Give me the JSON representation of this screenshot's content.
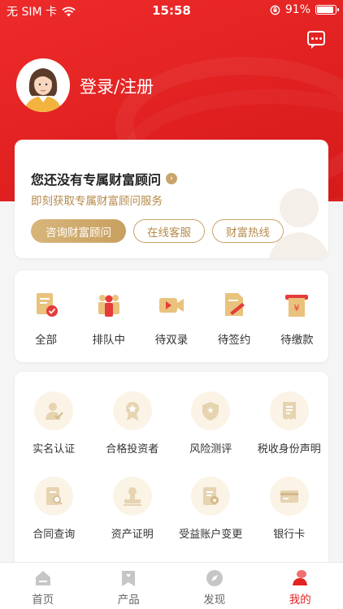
{
  "status_bar": {
    "carrier": "无 SIM 卡",
    "time": "15:58",
    "battery": "91%",
    "battery_level": 0.91
  },
  "header": {
    "login_label": "登录/注册"
  },
  "advisor": {
    "title": "您还没有专属财富顾问",
    "subtitle": "即刻获取专属财富顾问服务",
    "buttons": [
      "咨询财富顾问",
      "在线客服",
      "财富热线"
    ]
  },
  "orders": [
    {
      "label": "全部",
      "icon": "order-all-icon"
    },
    {
      "label": "排队中",
      "icon": "queue-icon"
    },
    {
      "label": "待双录",
      "icon": "video-record-icon"
    },
    {
      "label": "待签约",
      "icon": "sign-icon"
    },
    {
      "label": "待缴款",
      "icon": "payment-icon"
    }
  ],
  "services": [
    {
      "label": "实名认证",
      "icon": "id-verify-icon"
    },
    {
      "label": "合格投资者",
      "icon": "qualified-investor-icon"
    },
    {
      "label": "风险测评",
      "icon": "risk-shield-icon"
    },
    {
      "label": "税收身份声明",
      "icon": "tax-document-icon"
    },
    {
      "label": "合同查询",
      "icon": "contract-search-icon"
    },
    {
      "label": "资产证明",
      "icon": "asset-stamp-icon"
    },
    {
      "label": "受益账户变更",
      "icon": "account-change-icon"
    },
    {
      "label": "银行卡",
      "icon": "bank-card-icon"
    }
  ],
  "tabbar": [
    {
      "label": "首页",
      "icon": "home-icon"
    },
    {
      "label": "产品",
      "icon": "product-icon"
    },
    {
      "label": "发现",
      "icon": "compass-icon"
    },
    {
      "label": "我的",
      "icon": "user-icon"
    }
  ],
  "colors": {
    "brand_red": "#e42222",
    "gold": "#c8a56a",
    "gold_text": "#b58a4a"
  }
}
